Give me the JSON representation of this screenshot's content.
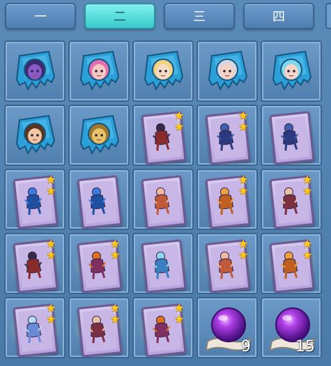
{
  "tabs": [
    {
      "label": "一",
      "active": false
    },
    {
      "label": "二",
      "active": true
    },
    {
      "label": "三",
      "active": false
    },
    {
      "label": "四",
      "active": false
    }
  ],
  "items": [
    {
      "kind": "shard",
      "hero": "purple-armored",
      "face": "#8a5ac8",
      "hair": "#3b2a6e"
    },
    {
      "kind": "shard",
      "hero": "pink-hair",
      "face": "#f3c9c2",
      "hair": "#e070b0"
    },
    {
      "kind": "shard",
      "hero": "blonde",
      "face": "#f6dcc6",
      "hair": "#f2d480"
    },
    {
      "kind": "shard",
      "hero": "silver-helmet",
      "face": "#f2d3c4",
      "hair": "#d7d7e3"
    },
    {
      "kind": "shard",
      "hero": "cyan-elf",
      "face": "#f4d5c8",
      "hair": "#7ed6f0"
    },
    {
      "kind": "shard",
      "hero": "brown-hair",
      "face": "#f1c6a4",
      "hair": "#5a3520"
    },
    {
      "kind": "shard",
      "hero": "golden-beast",
      "face": "#e8c26a",
      "hair": "#a07830"
    },
    {
      "kind": "card",
      "stars": 2,
      "figure": "dark-knight",
      "glow": false
    },
    {
      "kind": "card",
      "stars": 2,
      "figure": "blue-centaur",
      "glow": false
    },
    {
      "kind": "card",
      "stars": 0,
      "figure": "blue-centaur",
      "glow": false
    },
    {
      "kind": "card",
      "stars": 2,
      "figure": "blue-mage",
      "glow": false
    },
    {
      "kind": "card",
      "stars": 0,
      "figure": "blue-mage",
      "glow": false
    },
    {
      "kind": "card",
      "stars": 0,
      "figure": "bunny-girl",
      "glow": false
    },
    {
      "kind": "card",
      "stars": 2,
      "figure": "fox-girl",
      "glow": false
    },
    {
      "kind": "card",
      "stars": 2,
      "figure": "warrior-girl",
      "glow": false
    },
    {
      "kind": "card",
      "stars": 2,
      "figure": "dark-knight",
      "glow": true
    },
    {
      "kind": "card",
      "stars": 2,
      "figure": "fire-dragon",
      "glow": true
    },
    {
      "kind": "card",
      "stars": 0,
      "figure": "ice-wolf",
      "glow": true
    },
    {
      "kind": "card",
      "stars": 2,
      "figure": "bunny-girl",
      "glow": true
    },
    {
      "kind": "card",
      "stars": 2,
      "figure": "fox-girl",
      "glow": true
    },
    {
      "kind": "card",
      "stars": 2,
      "figure": "ice-fairy",
      "glow": true
    },
    {
      "kind": "card",
      "stars": 2,
      "figure": "warrior-girl",
      "glow": true
    },
    {
      "kind": "card",
      "stars": 2,
      "figure": "fire-dragon",
      "glow": true
    },
    {
      "kind": "orb",
      "count": "9"
    },
    {
      "kind": "orb",
      "count": "15"
    }
  ],
  "colors": {
    "shard": "#2aa0d8",
    "card_frame": "#6e5a93",
    "star": "#ffcc1a",
    "orb": "#8a2be2"
  }
}
